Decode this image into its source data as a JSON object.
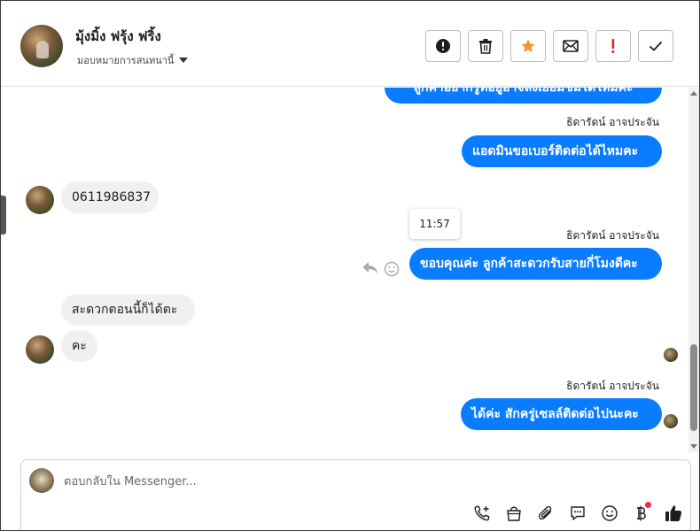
{
  "header": {
    "contact_name": "มุ้งมิ้ง ฟรุ้ง ฟริ้ง",
    "assign_label": "มอบหมายการสนทนานี้"
  },
  "actions": [
    {
      "name": "mark-spam-button",
      "icon": "exclamation-circle-icon"
    },
    {
      "name": "delete-button",
      "icon": "trash-icon"
    },
    {
      "name": "star-button",
      "icon": "star-icon",
      "color": "#f7923a"
    },
    {
      "name": "mark-unread-button",
      "icon": "envelope-icon"
    },
    {
      "name": "follow-up-button",
      "icon": "exclamation-icon",
      "color": "#e02020"
    },
    {
      "name": "mark-done-button",
      "icon": "check-icon"
    }
  ],
  "messages": {
    "partial_top": "ลูกค้าอยากรู้ที่อยู่อาจลงเยี่ยมชมได้ใหม่คะ",
    "m1_sender": "ธิดารัตน์ อาจประจัน",
    "m1_text": "แอดมินขอเบอร์ติดต่อได้ไหมคะ",
    "m2_text": "0611986837",
    "tooltip_time": "11:57",
    "m3_sender": "ธิดารัตน์ อาจประจัน",
    "m3_text": "ขอบคุณค่ะ ลูกค้าสะดวกรับสายกี่โมงดีคะ",
    "m4_text": "สะดวกตอนนี้ก็ได้ตะ",
    "m5_text": "คะ",
    "m6_sender": "ธิดารัตน์ อาจประจัน",
    "m6_text": "ได้ค่ะ สักครู่เซลล์ติดต่อไปนะคะ"
  },
  "composer": {
    "placeholder": "ตอบกลับใน Messenger...",
    "value": ""
  },
  "colors": {
    "outgoing_bubble": "#0a7cff",
    "incoming_bubble": "#f0f0f0",
    "notification_dot": "#f02849"
  }
}
